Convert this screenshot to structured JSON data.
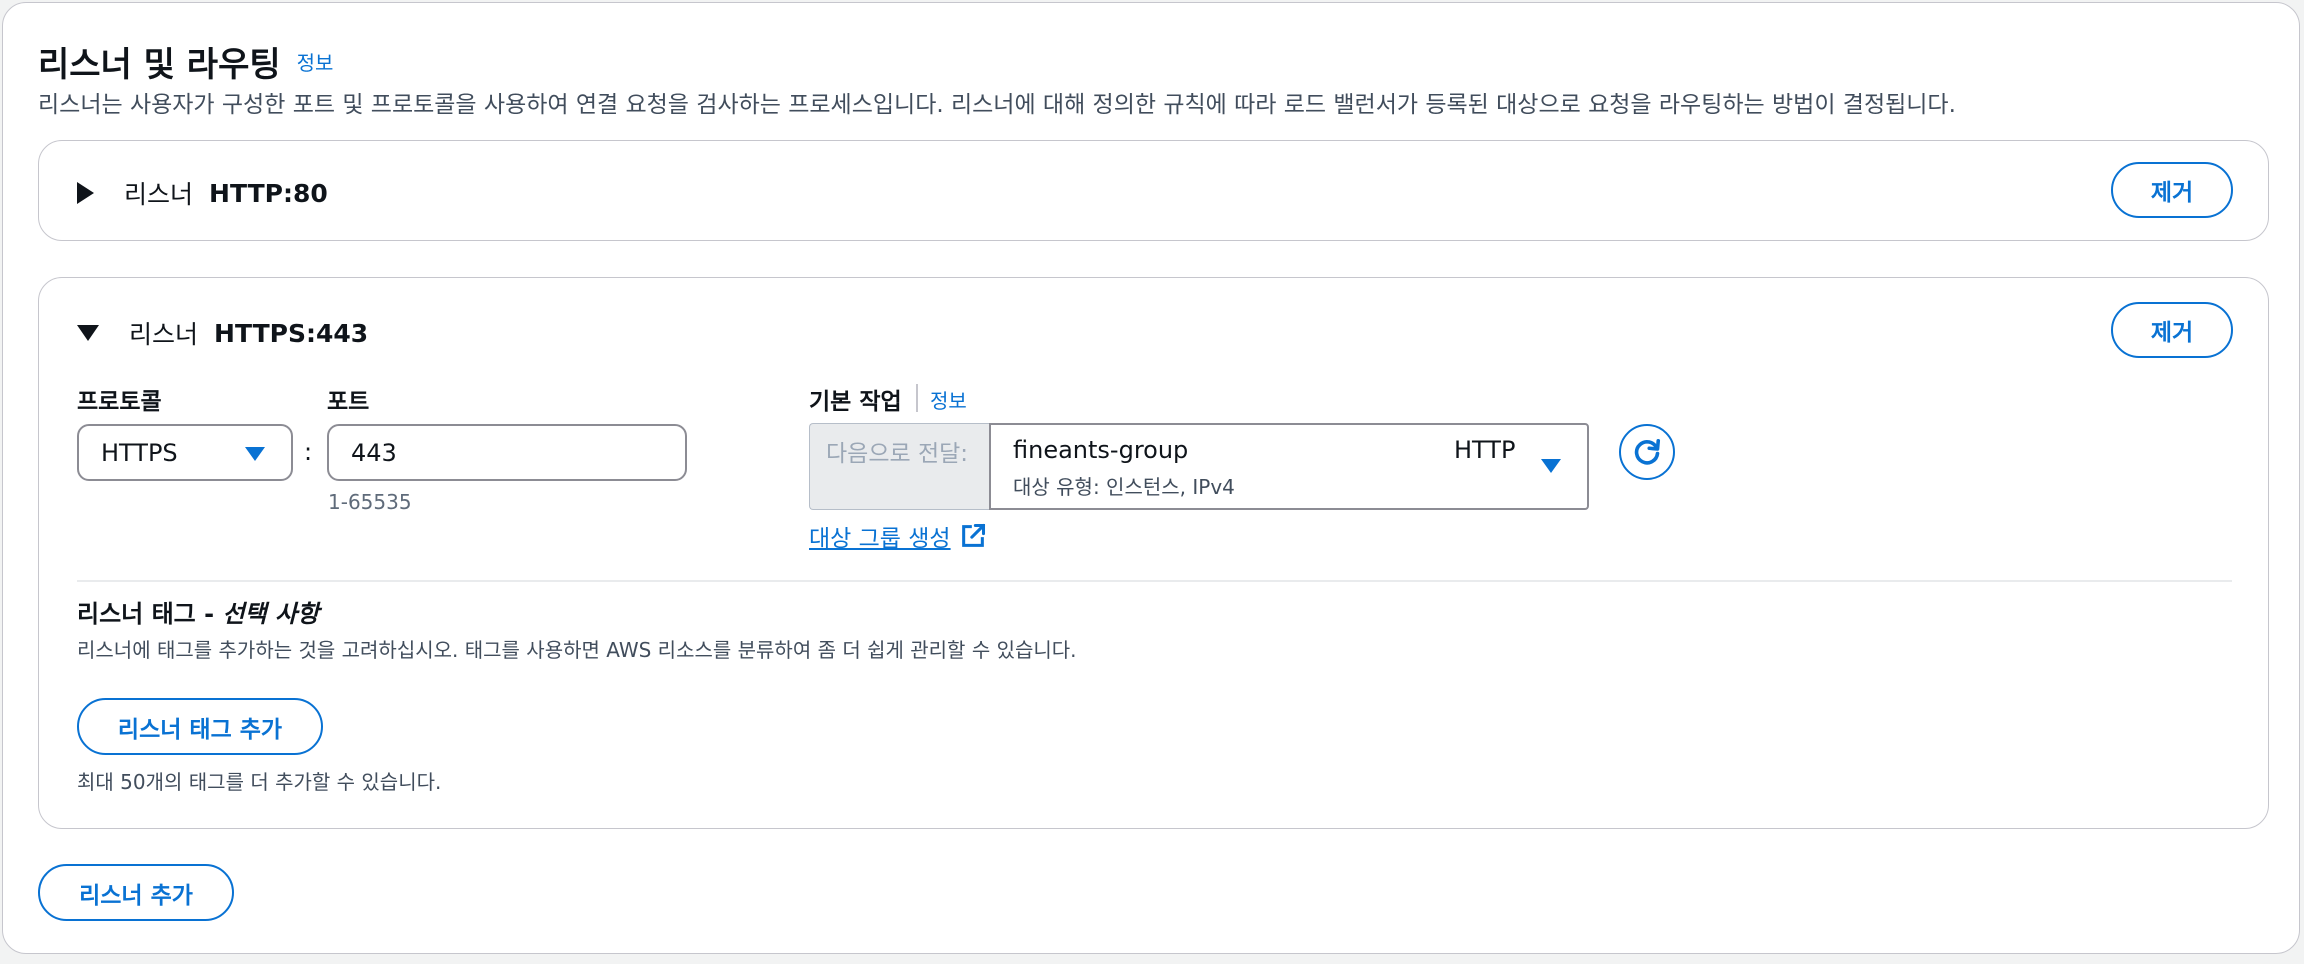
{
  "section": {
    "title": "리스너 및 라우팅",
    "info_label": "정보",
    "description": "리스너는 사용자가 구성한 포트 및 프로토콜을 사용하여 연결 요청을 검사하는 프로세스입니다. 리스너에 대해 정의한 규칙에 따라 로드 밸런서가 등록된 대상으로 요청을 라우팅하는 방법이 결정됩니다."
  },
  "listeners": [
    {
      "label": "리스너",
      "protocol_port": "HTTP:80",
      "expanded": false,
      "remove_label": "제거"
    },
    {
      "label": "리스너",
      "protocol_port": "HTTPS:443",
      "expanded": true,
      "remove_label": "제거",
      "protocol_label": "프로토콜",
      "protocol_value": "HTTPS",
      "port_label": "포트",
      "port_value": "443",
      "port_hint": "1-65535",
      "colon": ":",
      "default_action_label": "기본 작업",
      "default_action_info": "정보",
      "forward_prefix": "다음으로 전달:",
      "target_group_name": "fineants-group",
      "target_group_type": "대상 유형: 인스턴스, IPv4",
      "target_group_protocol": "HTTP",
      "create_target_group_label": "대상 그룹 생성",
      "tags_title": "리스너 태그 - ",
      "tags_title_optional": "선택 사항",
      "tags_description": "리스너에 태그를 추가하는 것을 고려하십시오. 태그를 사용하면 AWS 리소스를 분류하여 좀 더 쉽게 관리할 수 있습니다.",
      "add_tag_label": "리스너 태그 추가",
      "tags_limit": "최대 50개의 태그를 더 추가할 수 있습니다."
    }
  ],
  "add_listener_label": "리스너 추가",
  "colors": {
    "accent": "#0972d3",
    "text": "#0f141a",
    "border": "#c6c6cd"
  },
  "icons": [
    "caret-right-icon",
    "caret-down-icon",
    "dropdown-icon",
    "refresh-icon",
    "external-link-icon"
  ]
}
